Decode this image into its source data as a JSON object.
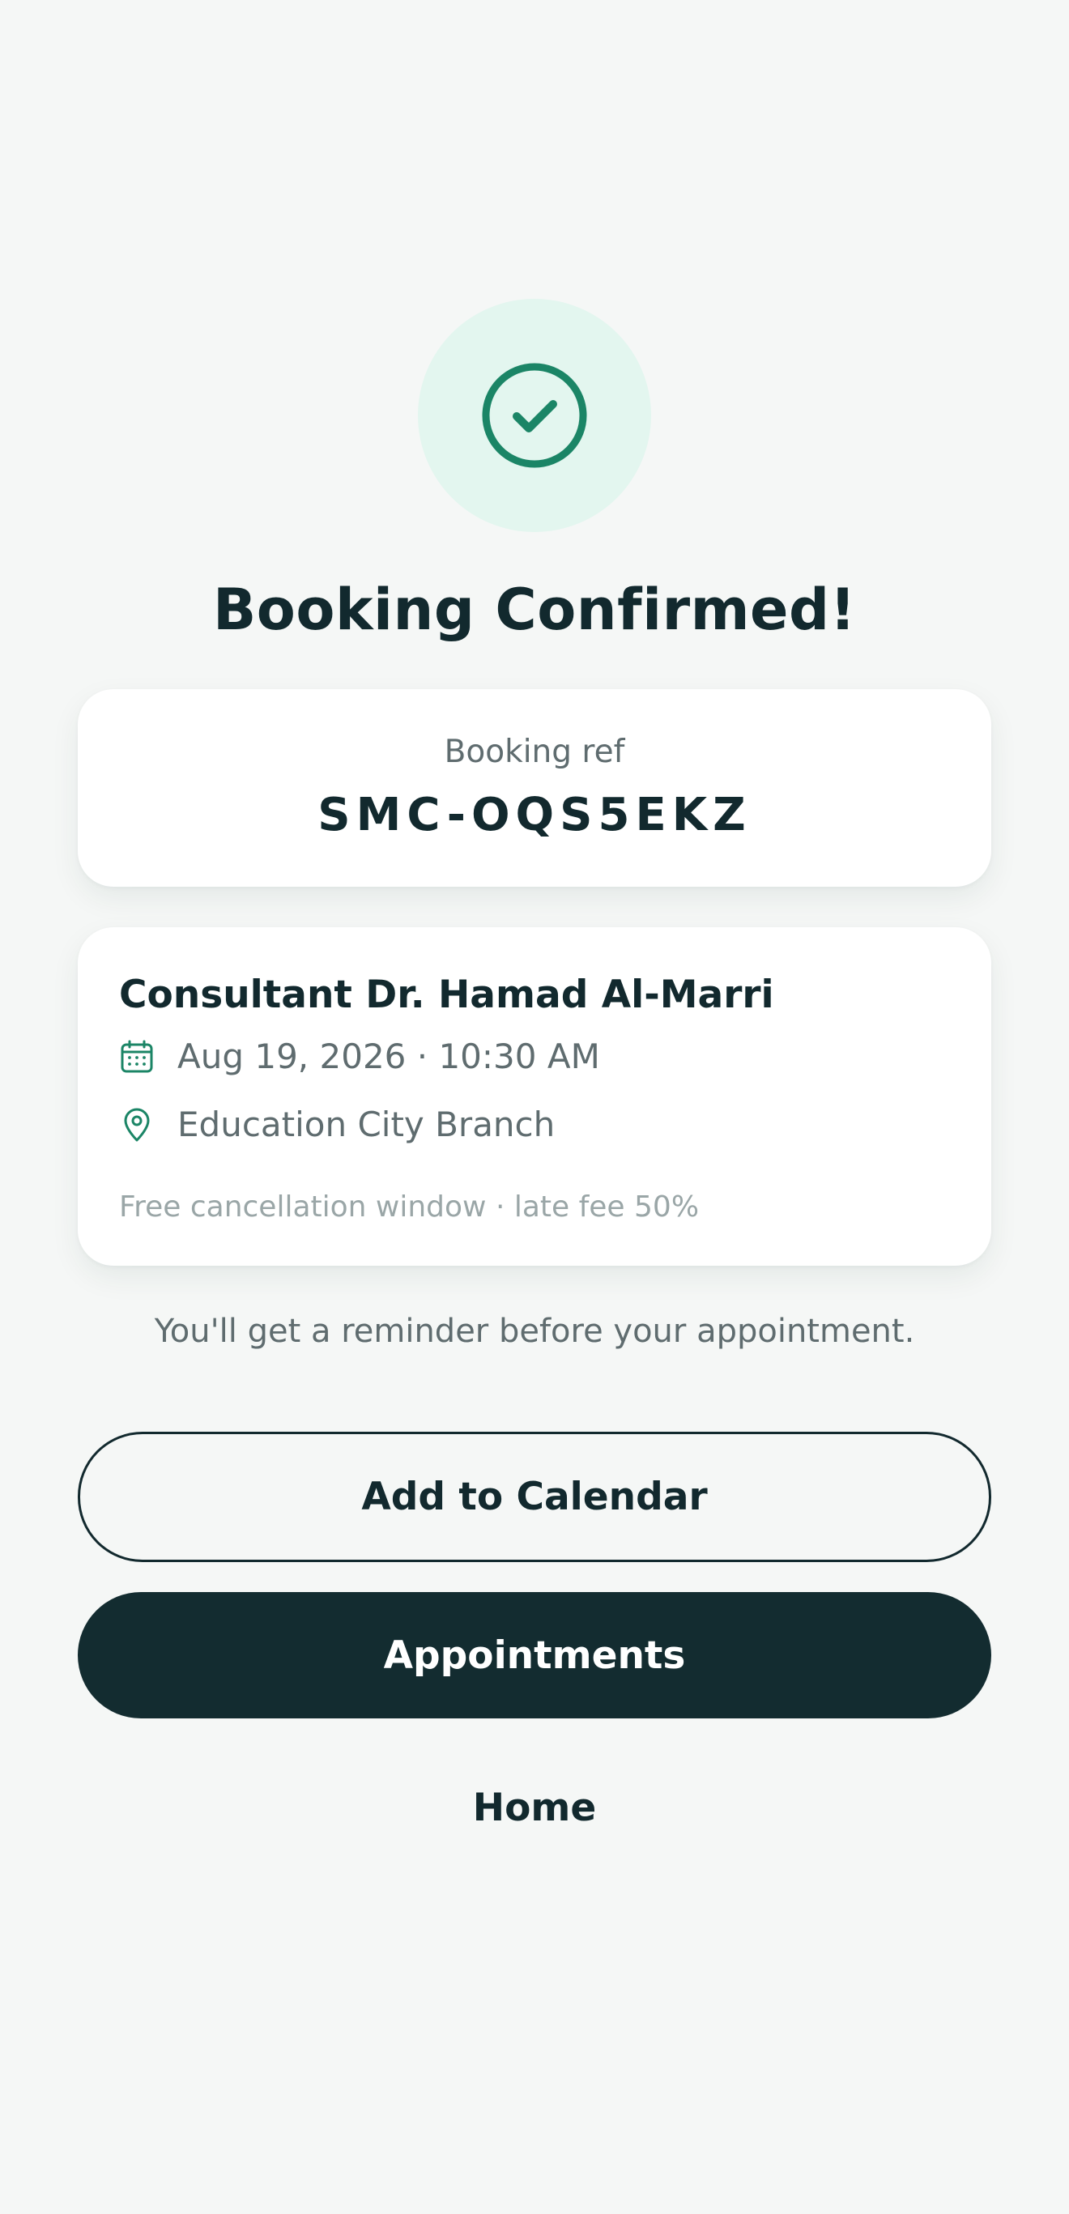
{
  "header": {
    "title": "Booking Confirmed!"
  },
  "icons": {
    "success": "check-circle-icon",
    "date": "calendar-icon",
    "location": "map-pin-icon"
  },
  "colors": {
    "accent": "#1b8566",
    "halo": "#e3f6ef",
    "primary_dark": "#132c30",
    "text_muted": "#5f6c6f",
    "text_subtle": "#9aa6a7",
    "background": "#f5f7f6"
  },
  "booking": {
    "ref_label": "Booking ref",
    "ref_code": "SMC-OQS5EKZ"
  },
  "appointment": {
    "consultant": "Consultant Dr. Hamad Al-Marri",
    "datetime": "Aug 19, 2026 · 10:30 AM",
    "location": "Education City Branch",
    "policy": "Free cancellation window · late fee 50%"
  },
  "reminder_text": "You'll get a reminder before your appointment.",
  "actions": {
    "add_to_calendar": "Add to Calendar",
    "appointments": "Appointments",
    "home": "Home"
  }
}
